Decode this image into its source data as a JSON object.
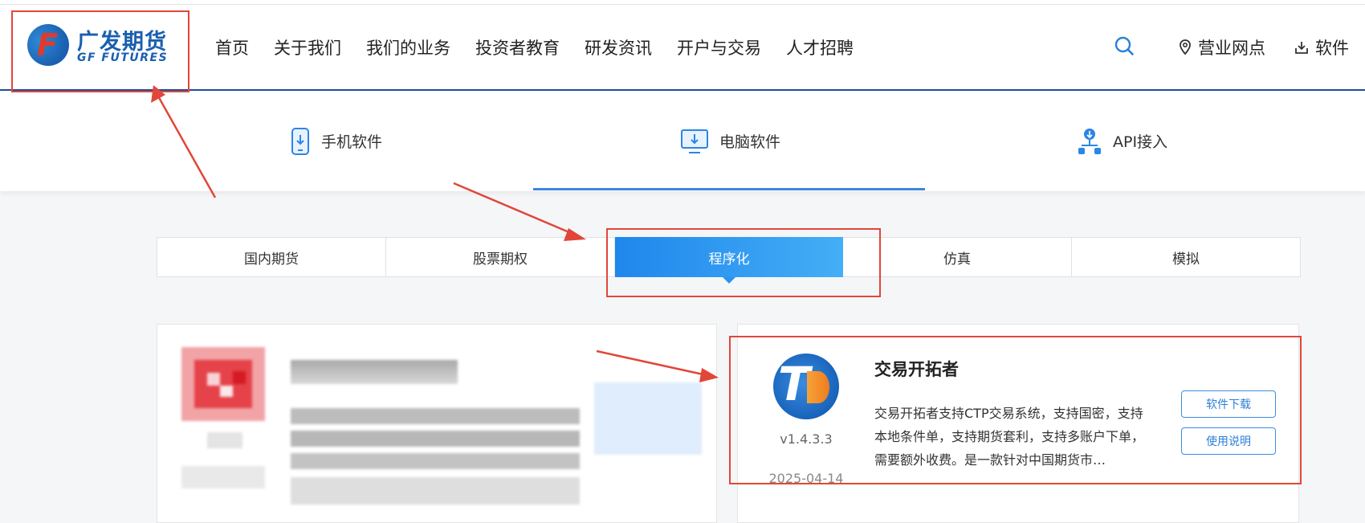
{
  "brand": {
    "name_cn": "广发期货",
    "name_en": "GF FUTURES",
    "logo_letter": "F"
  },
  "nav": {
    "items": [
      "首页",
      "关于我们",
      "我们的业务",
      "投资者教育",
      "研发资讯",
      "开户与交易",
      "人才招聘"
    ],
    "branches_label": "营业网点",
    "software_label": "软件"
  },
  "software_tabs": [
    {
      "label": "手机软件",
      "icon": "mobile-download-icon"
    },
    {
      "label": "电脑软件",
      "icon": "desktop-download-icon",
      "active": true
    },
    {
      "label": "API接入",
      "icon": "api-network-icon"
    }
  ],
  "categories": [
    {
      "label": "国内期货"
    },
    {
      "label": "股票期权"
    },
    {
      "label": "程序化",
      "active": true
    },
    {
      "label": "仿真"
    },
    {
      "label": "模拟"
    }
  ],
  "featured_app": {
    "title": "交易开拓者",
    "version": "v1.4.3.3",
    "date": "2025-04-14",
    "description": "交易开拓者支持CTP交易系统，支持国密，支持本地条件单，支持期货套利，支持多账户下单，需要额外收费。是一款针对中国期货市…",
    "download_label": "软件下载",
    "manual_label": "使用说明"
  },
  "colors": {
    "primary": "#1f4f9a",
    "accent": "#2b7fd8",
    "brand_red": "#e23a2a",
    "annotation": "#e2463a"
  }
}
